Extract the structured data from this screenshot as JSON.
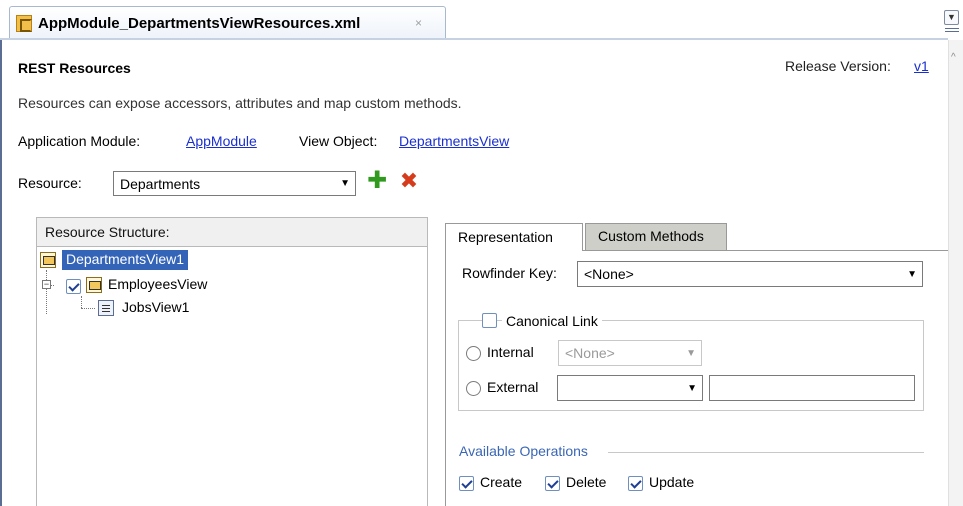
{
  "tab": {
    "filename": "AppModule_DepartmentsViewResources.xml",
    "close_glyph": "×"
  },
  "header": {
    "title": "REST Resources",
    "release_label": "Release Version:",
    "release_value": "v1",
    "description": "Resources can expose accessors, attributes and map custom methods."
  },
  "module": {
    "app_module_label": "Application Module:",
    "app_module_value": "AppModule",
    "view_object_label": "View Object:",
    "view_object_value": "DepartmentsView"
  },
  "resource": {
    "label": "Resource:",
    "selected": "Departments",
    "add_icon": "plus-icon",
    "delete_icon": "x-icon"
  },
  "structure": {
    "title": "Resource Structure:",
    "root": "DepartmentsView1",
    "child": {
      "label": "EmployeesView",
      "checked": true
    },
    "grandchild": "JobsView1"
  },
  "tabs": {
    "representation": "Representation",
    "custom_methods": "Custom Methods",
    "active": "representation"
  },
  "representation": {
    "rowfinder_label": "Rowfinder Key:",
    "rowfinder_value": "<None>",
    "canonical_link_label": "Canonical Link",
    "canonical_link_checked": false,
    "internal_label": "Internal",
    "internal_value": "<None>",
    "external_label": "External",
    "external_value": "",
    "external_text": ""
  },
  "operations": {
    "title": "Available Operations",
    "items": [
      {
        "label": "Create",
        "checked": true
      },
      {
        "label": "Delete",
        "checked": true
      },
      {
        "label": "Update",
        "checked": true
      }
    ]
  },
  "colors": {
    "link": "#1a2fcf",
    "selection": "#3464b8",
    "section_title": "#3a66b4"
  }
}
